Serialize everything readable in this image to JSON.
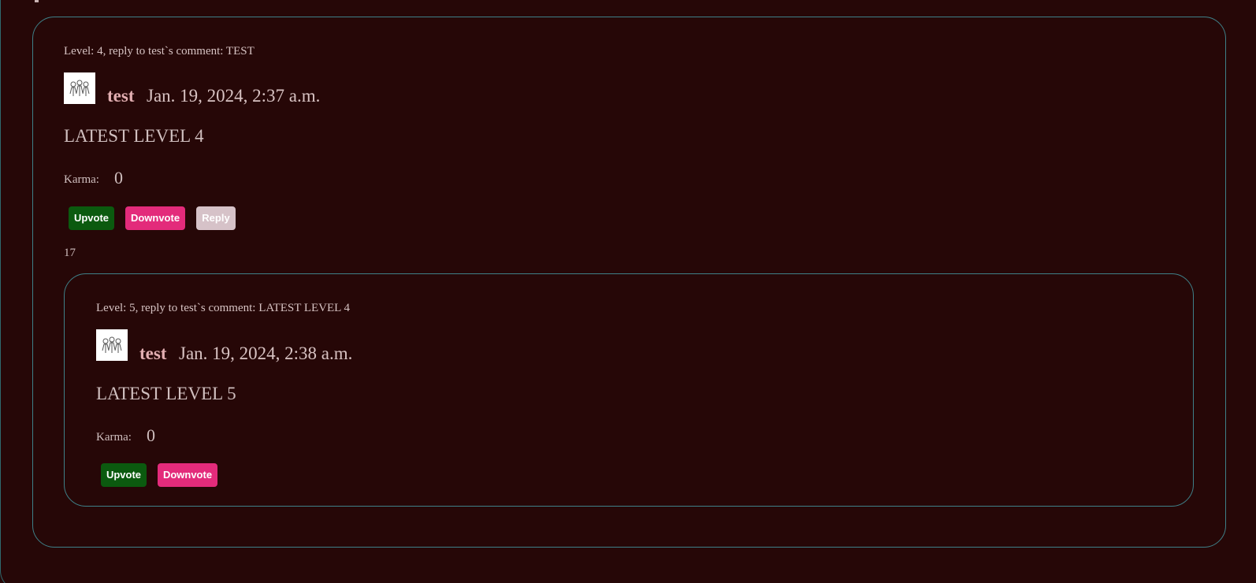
{
  "comments": [
    {
      "meta": "Level: 4, reply to test`s comment: TEST",
      "author": "test",
      "date": "Jan. 19, 2024, 2:37 a.m.",
      "body": "LATEST LEVEL 4",
      "karma_label": "Karma:",
      "karma_value": "0",
      "upvote_label": "Upvote",
      "downvote_label": "Downvote",
      "reply_label": "Reply",
      "reply_count": "17"
    },
    {
      "meta": "Level: 5, reply to test`s comment: LATEST LEVEL 4",
      "author": "test",
      "date": "Jan. 19, 2024, 2:38 a.m.",
      "body": "LATEST LEVEL 5",
      "karma_label": "Karma:",
      "karma_value": "0",
      "upvote_label": "Upvote",
      "downvote_label": "Downvote"
    }
  ],
  "avatar_icon": "group-of-people-icon",
  "colors": {
    "background": "#260707",
    "border": "#3e8088",
    "author": "#e2aeb1",
    "upvote": "#0b5a0f",
    "downvote": "#e32b7b",
    "reply": "#d6c2c8"
  }
}
